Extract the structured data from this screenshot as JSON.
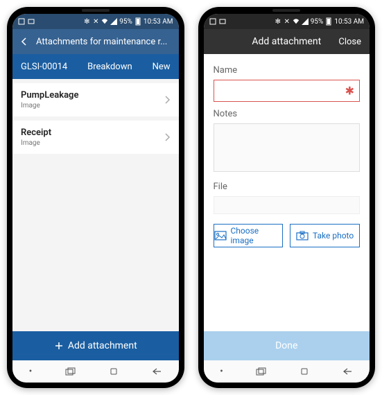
{
  "status": {
    "battery": "95%",
    "time": "10:53 AM"
  },
  "left": {
    "appbar_title": "Attachments for maintenance r...",
    "info": {
      "id": "GLSI-00014",
      "type": "Breakdown",
      "status": "New"
    },
    "items": [
      {
        "name": "PumpLeakage",
        "sub": "Image"
      },
      {
        "name": "Receipt",
        "sub": "Image"
      }
    ],
    "add_label": "Add attachment"
  },
  "right": {
    "title": "Add attachment",
    "close": "Close",
    "name_label": "Name",
    "name_value": "",
    "notes_label": "Notes",
    "notes_value": "",
    "file_label": "File",
    "choose_image": "Choose image",
    "take_photo": "Take photo",
    "done": "Done"
  },
  "nav": {
    "dot": "•"
  }
}
